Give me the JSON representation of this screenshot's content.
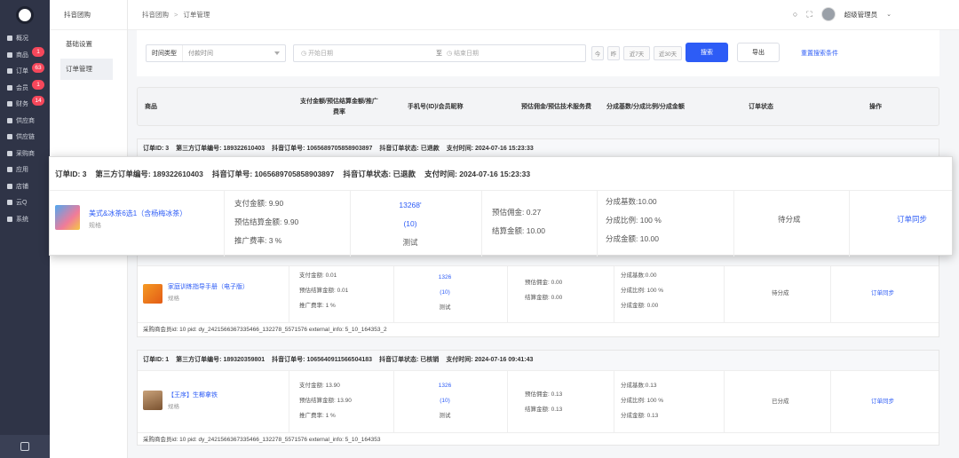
{
  "rail": {
    "items": [
      {
        "label": "概况",
        "icon": "chart-icon",
        "badge": null
      },
      {
        "label": "商品",
        "icon": "box-icon",
        "badge": "1"
      },
      {
        "label": "订单",
        "icon": "list-icon",
        "badge": "63"
      },
      {
        "label": "会员",
        "icon": "user-icon",
        "badge": "1"
      },
      {
        "label": "财务",
        "icon": "wallet-icon",
        "badge": "14"
      },
      {
        "label": "供应商",
        "icon": "person-icon",
        "badge": null
      },
      {
        "label": "供应链",
        "icon": "link-icon",
        "badge": null
      },
      {
        "label": "采购商",
        "icon": "cart-icon",
        "badge": null
      },
      {
        "label": "应用",
        "icon": "apps-icon",
        "badge": null
      },
      {
        "label": "店铺",
        "icon": "store-icon",
        "badge": null
      },
      {
        "label": "云Q",
        "icon": "cloud-icon",
        "badge": null
      },
      {
        "label": "系统",
        "icon": "gear-icon",
        "badge": null
      }
    ]
  },
  "subnav": {
    "title": "抖音团购",
    "items": [
      {
        "label": "基础设置",
        "active": false
      },
      {
        "label": "订单管理",
        "active": true
      }
    ]
  },
  "header": {
    "breadcrumb": [
      "抖音团购",
      "订单管理"
    ],
    "separator": ">",
    "user_name": "超级管理员"
  },
  "filters": {
    "time_type_label": "时间类型",
    "time_type_value": "付款时间",
    "start_placeholder": "开始日期",
    "range_sep": "至",
    "end_placeholder": "结束日期",
    "quick": [
      "今",
      "昨",
      "近7天",
      "近30天"
    ],
    "search_label": "搜索",
    "export_label": "导出",
    "reset_label": "重置搜索条件"
  },
  "table": {
    "headers": {
      "product": "商品",
      "payment_line1": "支付金额/预估结算金额/推广",
      "payment_line2": "费率",
      "member": "手机号(ID)/会员昵称",
      "commission": "预估佣金/预估技术服务费",
      "share": "分成基数/分成比例/分成金额",
      "status": "订单状态",
      "action": "操作"
    }
  },
  "popup": {
    "order_id": "订单ID: 3",
    "third_no": "第三方订单编号: 189322610403",
    "douyin_no": "抖音订单号: 1065689705858903897",
    "douyin_status": "抖音订单状态: 已退款",
    "pay_time": "支付时间: 2024-07-16 15:23:33",
    "product_name": "美式&冰茶6选1（含杨梅冰茶）",
    "product_spec": "规格",
    "pay_amount": "支付金额: 9.90",
    "settle_amount": "预估结算金额: 9.90",
    "promo_rate": "推广费率: 3 %",
    "member_phone": "13268'",
    "member_id": "(10)",
    "member_nick": "测试",
    "est_commission": "预估佣金: 0.27",
    "settled": "结算金额: 10.00",
    "share_base": "分成基数:10.00",
    "share_ratio": "分成比例: 100 %",
    "share_amount": "分成金额: 10.00",
    "status": "待分成",
    "action": "订单同步"
  },
  "orders": [
    {
      "header": [
        "订单ID: 3",
        "第三方订单编号: 189322610403",
        "抖音订单号: 1065689705858903897",
        "抖音订单状态: 已退款",
        "支付时间: 2024-07-16 15:23:33"
      ]
    },
    {
      "product_name": "家庭训练指导手册（电子版）",
      "product_spec": "规格",
      "pay_amount": "支付金额: 0.01",
      "settle_amount": "预估结算金额: 0.01",
      "promo_rate": "推广费率: 1 %",
      "member_phone": "1326",
      "member_id": "(10)",
      "member_nick": "测试",
      "est_commission": "预估佣金: 0.00",
      "settled": "结算金额: 0.00",
      "share_base": "分成基数:0.00",
      "share_ratio": "分成比例: 100 %",
      "share_amount": "分成金额: 0.00",
      "status": "待分成",
      "action": "订单同步",
      "footer": "采购商会员id: 10  pid: dy_2421566367335466_132278_5571576  external_info: 5_10_164353_2"
    },
    {
      "header": [
        "订单ID: 1",
        "第三方订单编号: 189320359801",
        "抖音订单号: 1065640911566504183",
        "抖音订单状态: 已核销",
        "支付时间: 2024-07-16 09:41:43"
      ],
      "product_name": "【王序】生椰拿铁",
      "product_spec": "规格",
      "pay_amount": "支付金额: 13.90",
      "settle_amount": "预估结算金额: 13.90",
      "promo_rate": "推广费率: 1 %",
      "member_phone": "1326",
      "member_id": "(10)",
      "member_nick": "测试",
      "est_commission": "预估佣金: 0.13",
      "settled": "结算金额: 0.13",
      "share_base": "分成基数:0.13",
      "share_ratio": "分成比例: 100 %",
      "share_amount": "分成金额: 0.13",
      "status": "已分成",
      "action": "订单同步",
      "footer": "采购商会员id: 10  pid: dy_2421566367335466_132278_5571576  external_info: 5_10_164353"
    }
  ],
  "colors": {
    "primary": "#2d5cf6",
    "badge": "#f5475b",
    "rail": "#2f3447"
  }
}
